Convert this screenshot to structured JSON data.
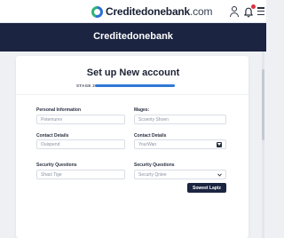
{
  "header": {
    "brand_name": "Creditedonebank",
    "brand_suffix": ".com",
    "icons": [
      "user-icon",
      "alert-icon",
      "menu-icon"
    ]
  },
  "banner": {
    "title": "Creditedonebank"
  },
  "page": {
    "title": "Set up New account",
    "stage_label": "STAGE 2",
    "progress_fraction": 1.0
  },
  "form": {
    "left": [
      {
        "label": "Personal Information",
        "value": "Petemurev"
      },
      {
        "label": "Contact Details",
        "value": "Ouispend"
      },
      {
        "label": "Security Questions",
        "value": "Shact Tige"
      }
    ],
    "right": [
      {
        "label": "Mages:",
        "value": "Scoenty Shoen"
      },
      {
        "label": "Contact Details",
        "value": "YourWan"
      },
      {
        "label": "Security Questions",
        "value": "Securty Qniee"
      }
    ],
    "submit_label": "Soweet Laptz"
  },
  "colors": {
    "navy": "#1b2440",
    "accent_blue": "#2f78d6",
    "page_bg": "#eef0f3"
  }
}
